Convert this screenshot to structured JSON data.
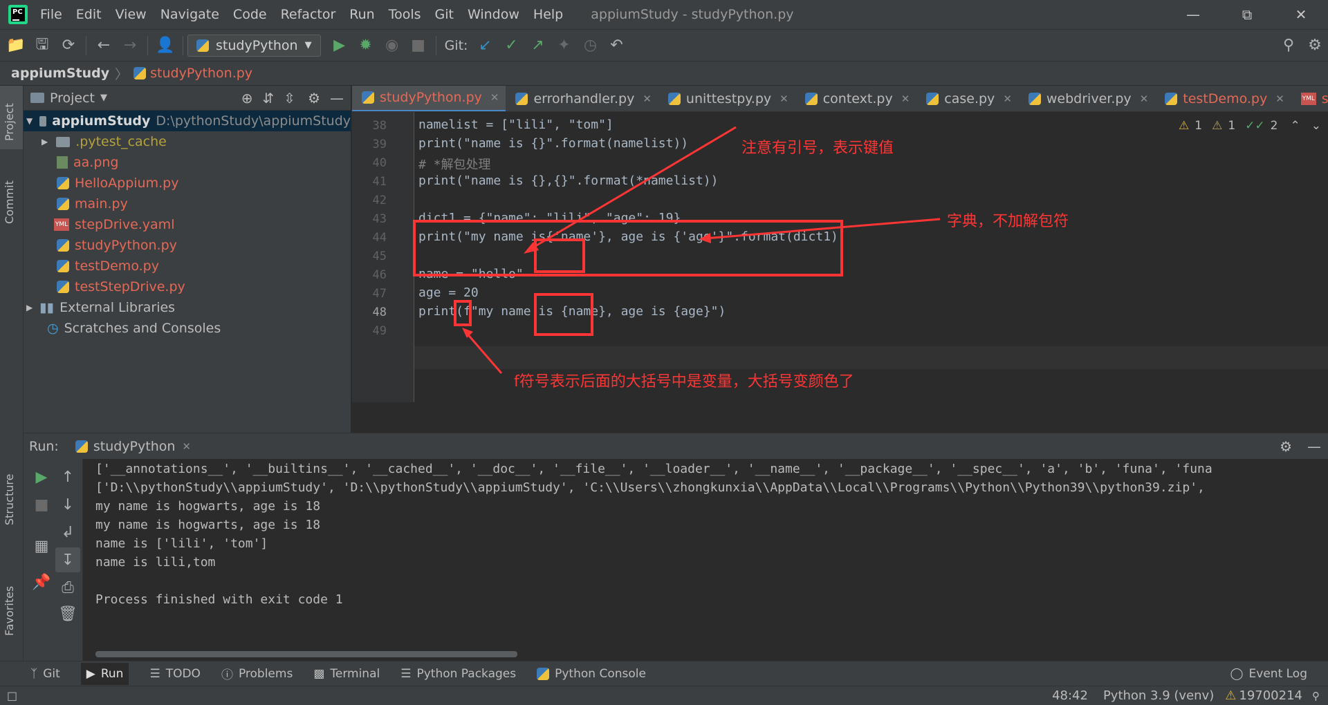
{
  "menu": [
    "File",
    "Edit",
    "View",
    "Navigate",
    "Code",
    "Refactor",
    "Run",
    "Tools",
    "Git",
    "Window",
    "Help"
  ],
  "window_title": "appiumStudy - studyPython.py",
  "app_logo_text": "PC",
  "toolbar": {
    "run_config": "studyPython",
    "git_label": "Git:"
  },
  "breadcrumb": {
    "project": "appiumStudy",
    "file": "studyPython.py"
  },
  "left_strip": {
    "project": "Project",
    "commit": "Commit",
    "structure": "Structure",
    "favorites": "Favorites"
  },
  "project_panel": {
    "title": "Project",
    "root_name": "appiumStudy",
    "root_path": "D:\\pythonStudy\\appiumStudy",
    "items": [
      {
        "label": ".pytest_cache",
        "type": "folder"
      },
      {
        "label": "aa.png",
        "type": "image"
      },
      {
        "label": "HelloAppium.py",
        "type": "py"
      },
      {
        "label": "main.py",
        "type": "py"
      },
      {
        "label": "stepDrive.yaml",
        "type": "yml"
      },
      {
        "label": "studyPython.py",
        "type": "py"
      },
      {
        "label": "testDemo.py",
        "type": "py"
      },
      {
        "label": "testStepDrive.py",
        "type": "py"
      }
    ],
    "external_libraries": "External Libraries",
    "scratches": "Scratches and Consoles"
  },
  "tabs": [
    {
      "label": "studyPython.py",
      "active": true
    },
    {
      "label": "errorhandler.py"
    },
    {
      "label": "unittestpy.py"
    },
    {
      "label": "context.py"
    },
    {
      "label": "case.py"
    },
    {
      "label": "webdriver.py"
    },
    {
      "label": "testDemo.py"
    },
    {
      "label": "stepI"
    }
  ],
  "inspections": {
    "warn1": "1",
    "warn2": "1",
    "ok": "2"
  },
  "editor": {
    "line_numbers": [
      "38",
      "39",
      "40",
      "41",
      "42",
      "43",
      "44",
      "45",
      "46",
      "47",
      "48",
      "49"
    ],
    "lines": [
      "namelist = [\"lili\", \"tom\"]",
      "print(\"name is {}\".format(namelist))",
      "# *解包处理",
      "print(\"name is {},{}\".format(*namelist))",
      "",
      "dict1 = {\"name\": \"lili\", \"age\": 19}",
      "print(\"my name is{'name'}, age is {'age'}\".format(dict1))",
      "",
      "name = \"hello\"",
      "age = 20",
      "print(f\"my name is {name}, age is {age}\")",
      ""
    ]
  },
  "annotations": {
    "quote_note": "注意有引号，表示键值",
    "dict_note": "字典，不加解包符",
    "fstring_note": "f符号表示后面的大括号中是变量，大括号变颜色了"
  },
  "run_panel": {
    "label": "Run:",
    "tab": "studyPython",
    "console": [
      "['__annotations__', '__builtins__', '__cached__', '__doc__', '__file__', '__loader__', '__name__', '__package__', '__spec__', 'a', 'b', 'funa', 'funa",
      "['D:\\\\pythonStudy\\\\appiumStudy', 'D:\\\\pythonStudy\\\\appiumStudy', 'C:\\\\Users\\\\zhongkunxia\\\\AppData\\\\Local\\\\Programs\\\\Python\\\\Python39\\\\python39.zip',",
      "my name is hogwarts, age is 18",
      "my name is hogwarts, age is 18",
      "name is ['lili', 'tom']",
      "name is lili,tom",
      "",
      "Process finished with exit code 1"
    ]
  },
  "bottom_tabs": [
    "Git",
    "Run",
    "TODO",
    "Problems",
    "Terminal",
    "Python Packages",
    "Python Console"
  ],
  "event_log": "Event Log",
  "status": {
    "position": "48:42",
    "interpreter": "Python 3.9 (venv)",
    "warnings": "19700214"
  }
}
